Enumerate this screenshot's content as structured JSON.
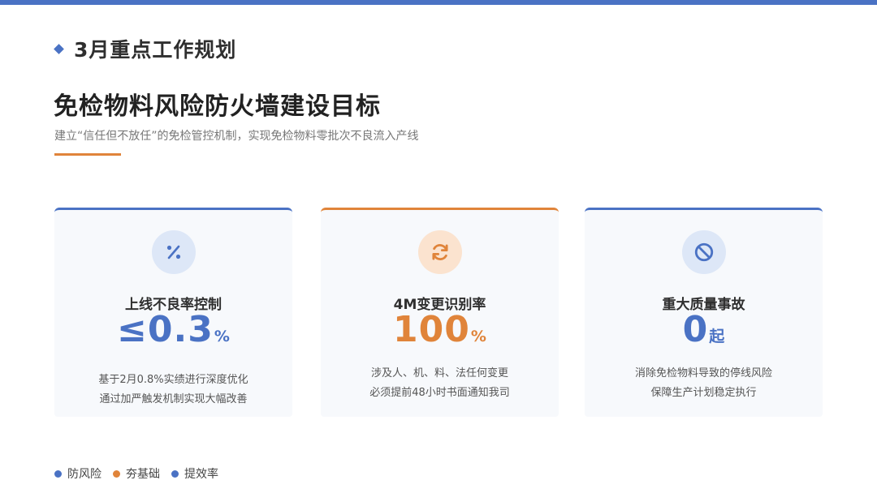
{
  "header": {
    "section_title": "3月重点工作规划",
    "main_title": "免检物料风险防火墙建设目标",
    "subtitle": "建立“信任但不放任”的免检管控机制，实现免检物料零批次不良流入产线"
  },
  "colors": {
    "blue": "#4a72c4",
    "orange": "#e0843a"
  },
  "cards": [
    {
      "icon": "percent-icon",
      "label": "上线不良率控制",
      "value": "≤0.3",
      "unit": "%",
      "desc": [
        "基于2月0.8%实绩进行深度优化",
        "通过加严触发机制实现大幅改善"
      ],
      "accent": "blue"
    },
    {
      "icon": "refresh-icon",
      "label": "4M变更识别率",
      "value": "100",
      "unit": "%",
      "desc": [
        "涉及人、机、料、法任何变更",
        "必须提前48小时书面通知我司"
      ],
      "accent": "orange"
    },
    {
      "icon": "prohibited-icon",
      "label": "重大质量事故",
      "value": "0",
      "unit": "起",
      "desc": [
        "消除免检物料导致的停线风险",
        "保障生产计划稳定执行"
      ],
      "accent": "blue"
    }
  ],
  "legend": [
    {
      "label": "防风险",
      "color": "#4a72c4"
    },
    {
      "label": "夯基础",
      "color": "#e0843a"
    },
    {
      "label": "提效率",
      "color": "#4a72c4"
    }
  ]
}
